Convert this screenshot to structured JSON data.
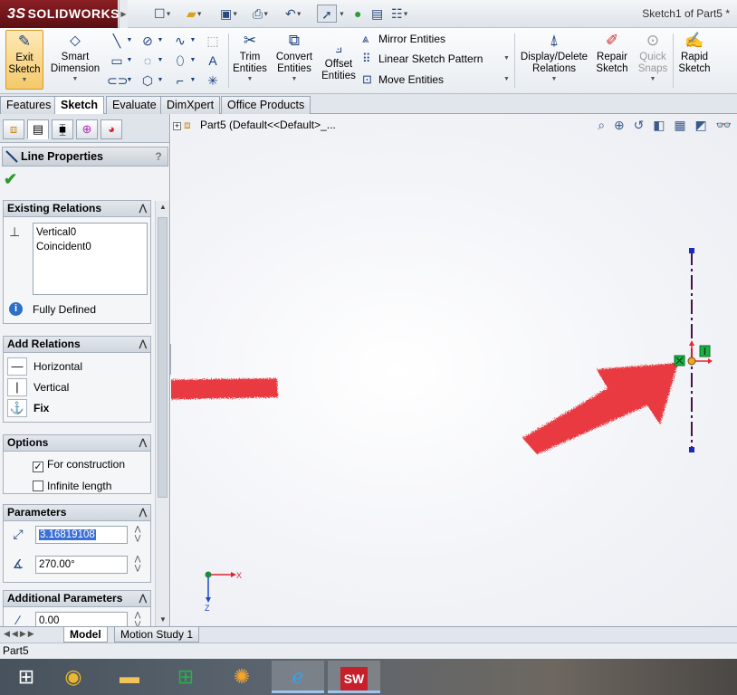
{
  "app": {
    "logo_text": "SOLIDWORKS",
    "logo_prefix": "3S",
    "doc_title": "Sketch1 of Part5 *"
  },
  "toolbar": {
    "exit_sketch": [
      "Exit",
      "Sketch"
    ],
    "smart_dimension": [
      "Smart",
      "Dimension"
    ],
    "trim_entities": [
      "Trim",
      "Entities"
    ],
    "convert_entities": [
      "Convert",
      "Entities"
    ],
    "offset_entities": [
      "Offset",
      "Entities"
    ],
    "mirror_entities": "Mirror Entities",
    "linear_sketch_pattern": "Linear Sketch Pattern",
    "move_entities": "Move Entities",
    "display_delete_relations": [
      "Display/Delete",
      "Relations"
    ],
    "repair_sketch": [
      "Repair",
      "Sketch"
    ],
    "quick_snaps": [
      "Quick",
      "Snaps"
    ],
    "rapid_sketch": [
      "Rapid",
      "Sketch"
    ]
  },
  "tabs": [
    "Features",
    "Sketch",
    "Evaluate",
    "DimXpert",
    "Office Products"
  ],
  "active_tab": "Sketch",
  "property_manager": {
    "title": "Line Properties",
    "help": "?",
    "existing_relations": {
      "header": "Existing Relations",
      "items": [
        "Vertical0",
        "Coincident0"
      ],
      "status": "Fully Defined"
    },
    "add_relations": {
      "header": "Add Relations",
      "items": [
        "Horizontal",
        "Vertical",
        "Fix"
      ]
    },
    "options": {
      "header": "Options",
      "for_construction": "For construction",
      "for_construction_checked": true,
      "infinite_length": "Infinite length",
      "infinite_length_checked": false
    },
    "parameters": {
      "header": "Parameters",
      "length": "3.16819108",
      "angle": "270.00°"
    },
    "additional_parameters": {
      "header": "Additional Parameters",
      "value": "0.00"
    }
  },
  "tree": {
    "root_label": "Part5  (Default<<Default>_..."
  },
  "triad": {
    "x_label": "X",
    "z_label": "Z"
  },
  "bottom_tabs": [
    "Model",
    "Motion Study 1"
  ],
  "status_bar": "Part5",
  "colors": {
    "annotation_arrow": "#e8262e",
    "construction_line": "#4b0f4b",
    "endpoint": "#1b2ab8",
    "relation_badge": "#19b244"
  }
}
